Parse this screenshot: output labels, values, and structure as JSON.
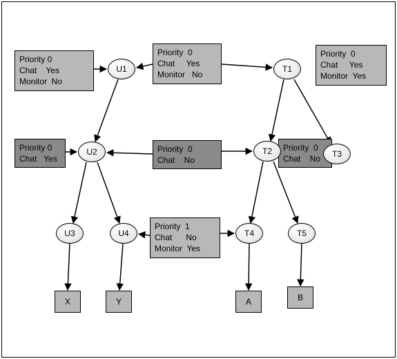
{
  "nodes": {
    "U1": "U1",
    "U2": "U2",
    "U3": "U3",
    "U4": "U4",
    "T1": "T1",
    "T2": "T2",
    "T3": "T3",
    "T4": "T4",
    "T5": "T5"
  },
  "leaves": {
    "X": "X",
    "Y": "Y",
    "A": "A",
    "B": "B"
  },
  "attrboxes": {
    "u1_attrs": "Priority 0\nChat    Yes\nMonitor  No",
    "root_attrs": "Priority  0\nChat     Yes\nMonitor   No",
    "t1_attrs": "Priority  0\nChat     Yes\nMonitor  Yes",
    "u2_attrs": "Priority 0\nChat   Yes",
    "mid_attrs": "Priority  0\nChat    No",
    "t2_attrs": "Priority  0\nChat    No",
    "u4t4_attrs": "Priority  1\nChat      No\nMonitor  Yes"
  },
  "chart_data": {
    "type": "tree",
    "description": "Hierarchical tree with attribute annotations on selected nodes",
    "nodes": [
      {
        "id": "root",
        "label": "",
        "type": "implicit",
        "attrs": {
          "Priority": 0,
          "Chat": "Yes",
          "Monitor": "No"
        }
      },
      {
        "id": "U1",
        "label": "U1",
        "type": "ellipse",
        "attrs": {
          "Priority": 0,
          "Chat": "Yes",
          "Monitor": "No"
        }
      },
      {
        "id": "T1",
        "label": "T1",
        "type": "ellipse",
        "attrs": {
          "Priority": 0,
          "Chat": "Yes",
          "Monitor": "Yes"
        }
      },
      {
        "id": "U2",
        "label": "U2",
        "type": "ellipse",
        "attrs": {
          "Priority": 0,
          "Chat": "Yes"
        }
      },
      {
        "id": "T2",
        "label": "T2",
        "type": "ellipse",
        "attrs": {
          "Priority": 0,
          "Chat": "No"
        }
      },
      {
        "id": "T3",
        "label": "T3",
        "type": "ellipse"
      },
      {
        "id": "U3",
        "label": "U3",
        "type": "ellipse"
      },
      {
        "id": "U4",
        "label": "U4",
        "type": "ellipse",
        "attrs": {
          "Priority": 1,
          "Chat": "No",
          "Monitor": "Yes"
        }
      },
      {
        "id": "T4",
        "label": "T4",
        "type": "ellipse",
        "attrs": {
          "Priority": 1,
          "Chat": "No",
          "Monitor": "Yes"
        }
      },
      {
        "id": "T5",
        "label": "T5",
        "type": "ellipse"
      },
      {
        "id": "X",
        "label": "X",
        "type": "leaf"
      },
      {
        "id": "Y",
        "label": "Y",
        "type": "leaf"
      },
      {
        "id": "A",
        "label": "A",
        "type": "leaf"
      },
      {
        "id": "B",
        "label": "B",
        "type": "leaf"
      }
    ],
    "edges": [
      {
        "from": "root",
        "to": "U1"
      },
      {
        "from": "root",
        "to": "T1"
      },
      {
        "from": "U1",
        "to": "U2"
      },
      {
        "from": "T1",
        "to": "T2"
      },
      {
        "from": "T1",
        "to": "T3"
      },
      {
        "from": "U2",
        "to": "U3"
      },
      {
        "from": "U2",
        "to": "U4"
      },
      {
        "from": "T2",
        "to": "T4"
      },
      {
        "from": "T2",
        "to": "T5"
      },
      {
        "from": "U3",
        "to": "X"
      },
      {
        "from": "U4",
        "to": "Y"
      },
      {
        "from": "T4",
        "to": "A"
      },
      {
        "from": "T5",
        "to": "B"
      }
    ],
    "shared_attr_boxes": [
      {
        "between": [
          "U2",
          "T2"
        ],
        "attrs": {
          "Priority": 0,
          "Chat": "No"
        }
      },
      {
        "between": [
          "U4",
          "T4"
        ],
        "attrs": {
          "Priority": 1,
          "Chat": "No",
          "Monitor": "Yes"
        }
      }
    ]
  }
}
